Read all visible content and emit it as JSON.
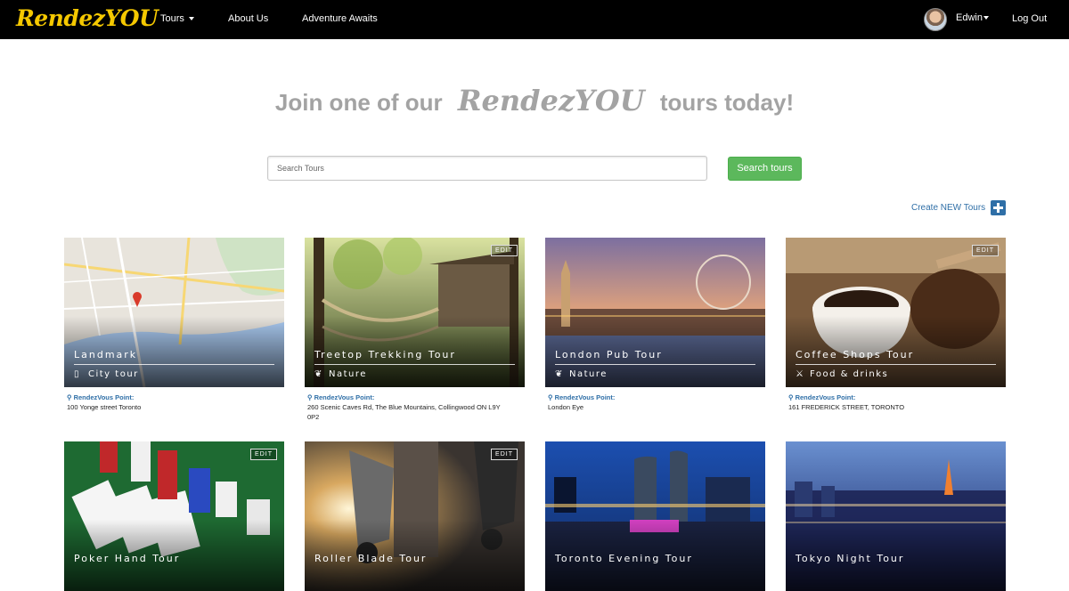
{
  "nav": {
    "logo": "RendezYOU",
    "tours": "Tours",
    "about": "About Us",
    "adventure": "Adventure Awaits",
    "user": "Edwin",
    "logout": "Log Out"
  },
  "hero": {
    "pre": "Join one of our",
    "brand": "RendezYOU",
    "post": "tours today!"
  },
  "search": {
    "placeholder": "Search Tours",
    "button": "Search tours"
  },
  "create": {
    "label": "Create NEW Tours"
  },
  "rendezvous_label": "RendezVous Point:",
  "edit_label": "EDIT",
  "tours": [
    {
      "title": "Landmark",
      "category": "City tour",
      "icon": "building-icon",
      "address": "100 Yonge street Toronto"
    },
    {
      "title": "Treetop Trekking Tour",
      "category": "Nature",
      "icon": "leaf-icon",
      "address": "260 Scenic Caves Rd, The Blue Mountains, Collingwood ON L9Y 0P2"
    },
    {
      "title": "London Pub Tour",
      "category": "Nature",
      "icon": "leaf-icon",
      "address": "London Eye"
    },
    {
      "title": "Coffee Shops Tour",
      "category": "Food & drinks",
      "icon": "cutlery-icon",
      "address": "161 FREDERICK STREET, TORONTO"
    },
    {
      "title": "Poker Hand Tour",
      "category": "",
      "icon": "",
      "address": ""
    },
    {
      "title": "Roller Blade Tour",
      "category": "",
      "icon": "",
      "address": ""
    },
    {
      "title": "Toronto Evening Tour",
      "category": "",
      "icon": "",
      "address": ""
    },
    {
      "title": "Tokyo Night Tour",
      "category": "",
      "icon": "",
      "address": ""
    }
  ],
  "colors": {
    "navbar": "#000000",
    "logo": "#f5c800",
    "accent": "#2f6fa7",
    "search_button": "#5cb85c"
  }
}
